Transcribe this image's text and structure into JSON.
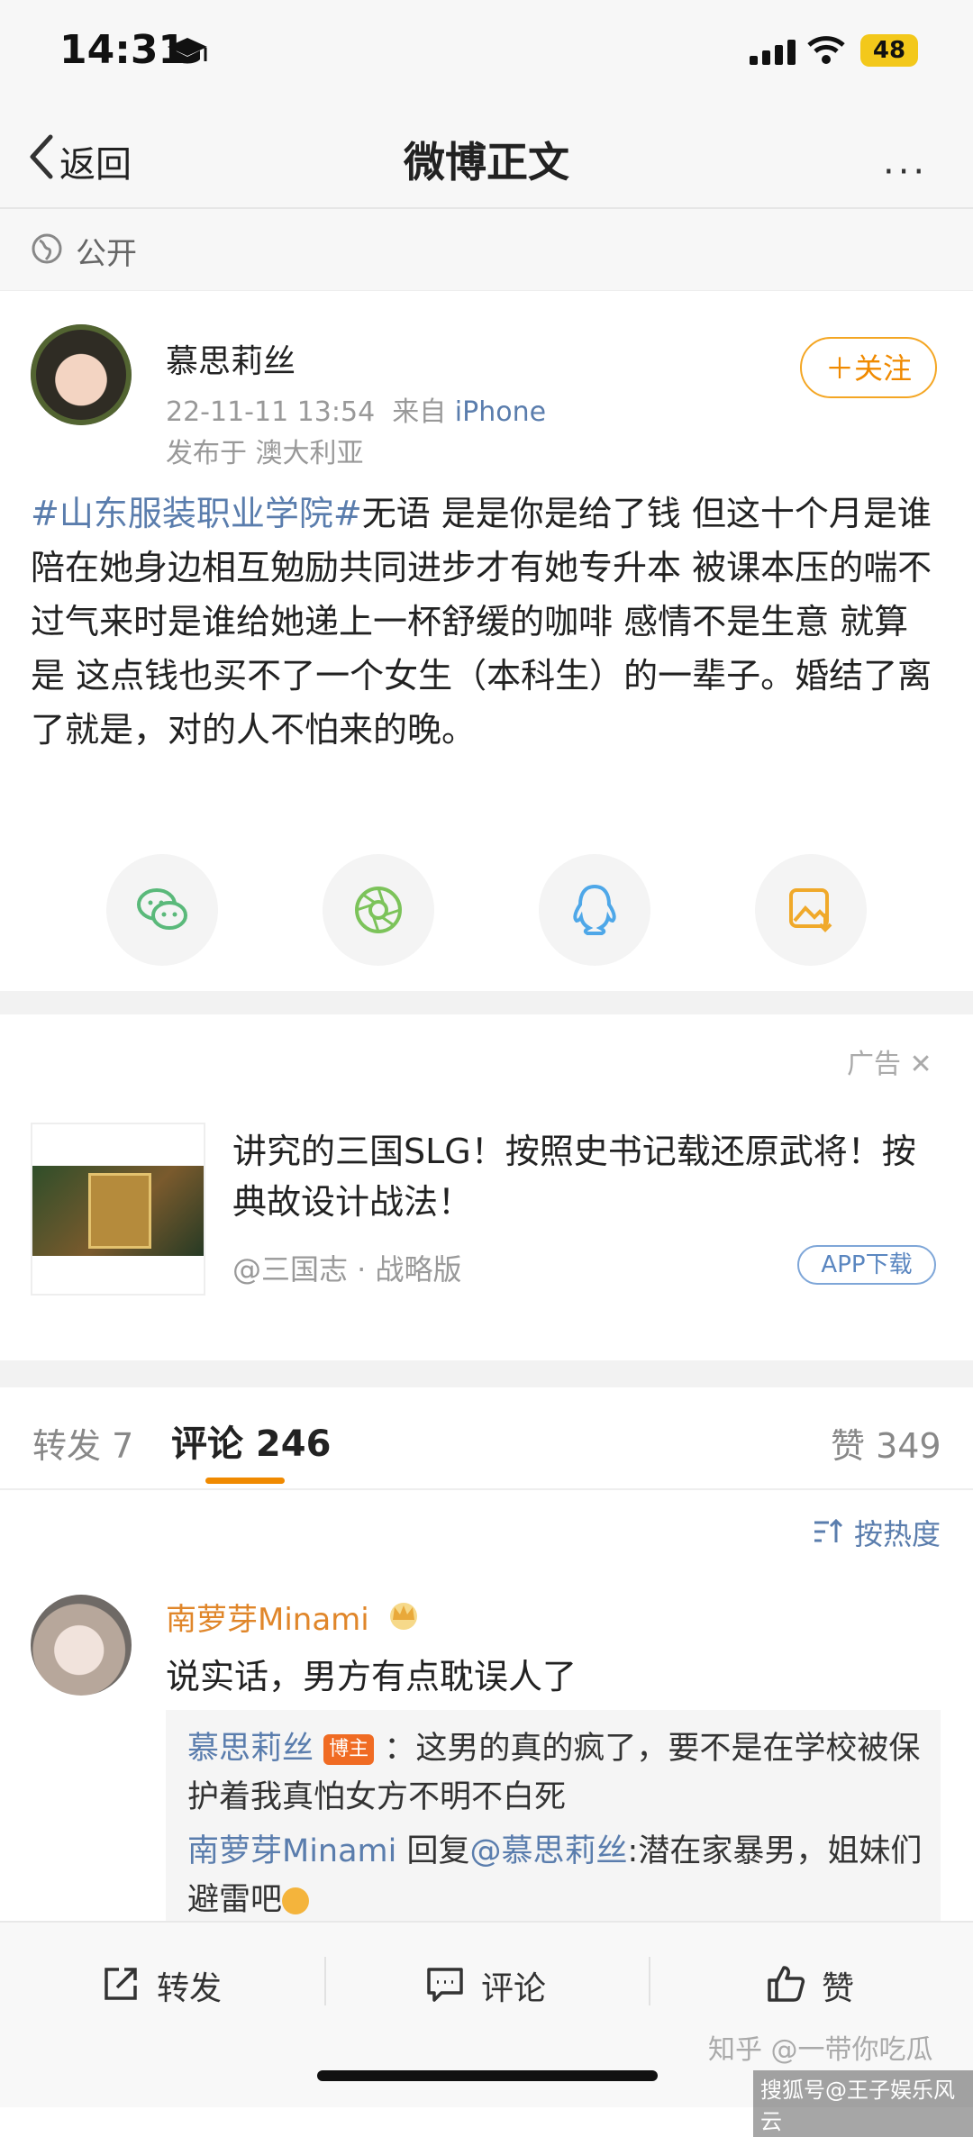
{
  "status_bar": {
    "time": "14:31",
    "battery": "48"
  },
  "nav": {
    "back_label": "返回",
    "title": "微博正文",
    "more": "···"
  },
  "visibility": {
    "label": "公开"
  },
  "post": {
    "author": "慕思莉丝",
    "date": "22-11-11 13:54",
    "from_prefix": "来自",
    "device": "iPhone",
    "location": "发布于 澳大利亚",
    "follow_label": "＋关注",
    "hashtag": "#山东服装职业学院#",
    "text": "无语 是是你是给了钱 但这十个月是谁陪在她身边相互勉励共同进步才有她专升本 被课本压的喘不过气来时是谁给她递上一杯舒缓的咖啡 感情不是生意 就算是 这点钱也买不了一个女生（本科生）的一辈子。婚结了离了就是，对的人不怕来的晚。"
  },
  "share_icons": [
    "wechat-icon",
    "moments-icon",
    "qq-icon",
    "save-image-icon"
  ],
  "ad": {
    "tag": "广告",
    "close": "✕",
    "title": "讲究的三国SLG！按照史书记载还原武将！按典故设计战法！",
    "source": "@三国志 · 战略版",
    "button": "APP下载"
  },
  "tabs": {
    "forward": "转发 7",
    "comments": "评论 246",
    "likes": "赞 349",
    "sort": "按热度"
  },
  "comment": {
    "name": "南萝芽Minami",
    "text": "说实话，男方有点耽误人了",
    "reply1_name": "慕思莉丝",
    "reply1_badge": "博主",
    "reply1_text": "：这男的真的疯了，要不是在学校被保护着我真怕女方不明不白死",
    "reply2_name": "南萝芽Minami",
    "reply2_mid": "回复",
    "reply2_target": "@慕思莉丝",
    "reply2_text": ":潜在家暴男，姐妹们避雷吧"
  },
  "bottom_bar": {
    "forward": "转发",
    "comment": "评论",
    "like": "赞"
  },
  "watermarks": {
    "zhihu": "知乎 @一带你吃瓜",
    "sohu": "搜狐号@王子娱乐风云"
  },
  "colors": {
    "accent": "#f08a00",
    "link": "#5a7dad",
    "username": "#e0862a",
    "badge": "#f06b23"
  }
}
